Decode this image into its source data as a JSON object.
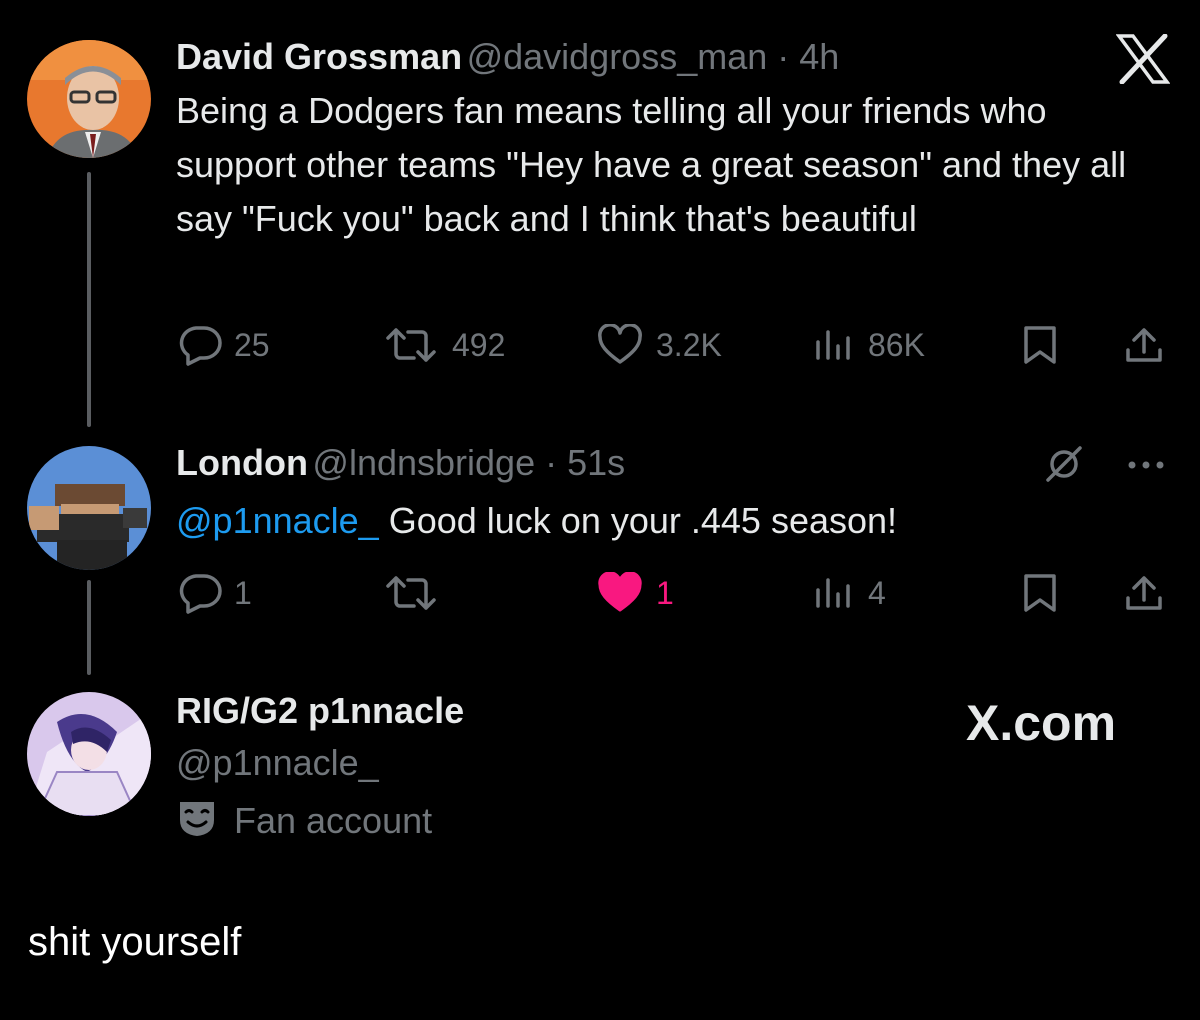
{
  "tweet1": {
    "name": "David Grossman",
    "handle": "@davidgross_man",
    "time": "4h",
    "text": "Being a Dodgers fan means telling all your friends who support other teams \"Hey have a great season\" and they all say \"Fuck you\" back and I think that's beautiful",
    "replies": "25",
    "reposts": "492",
    "likes": "3.2K",
    "views": "86K",
    "corner_icon": "x-logo-icon"
  },
  "tweet2": {
    "name": "London",
    "handle": "@lndnsbridge",
    "time": "51s",
    "mention": "@p1nnacle_",
    "text": " Good luck on your .445 season!",
    "replies": "1",
    "likes": "1",
    "views": "4",
    "liked": true
  },
  "profile": {
    "name": "RIG/G2 p1nnacle",
    "handle": "@p1nnacle_",
    "label": "Fan account",
    "watermark": "X.com"
  },
  "caption": "shit yourself",
  "colors": {
    "background": "#000000",
    "text": "#e7e9ea",
    "muted": "#71767b",
    "mention": "#1d9bf0",
    "like": "#f91880"
  }
}
